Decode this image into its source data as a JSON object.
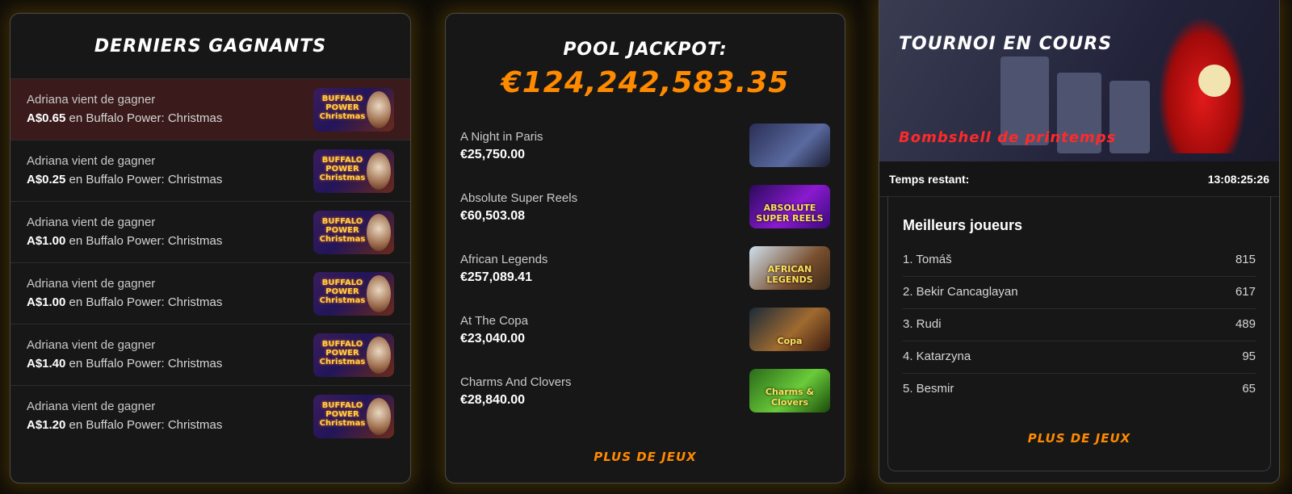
{
  "winners": {
    "title": "Derniers gagnants",
    "items": [
      {
        "text": "Adriana vient de gagner",
        "amount": "A$0.65",
        "game": "en Buffalo Power: Christmas"
      },
      {
        "text": "Adriana vient de gagner",
        "amount": "A$0.25",
        "game": "en Buffalo Power: Christmas"
      },
      {
        "text": "Adriana vient de gagner",
        "amount": "A$1.00",
        "game": "en Buffalo Power: Christmas"
      },
      {
        "text": "Adriana vient de gagner",
        "amount": "A$1.00",
        "game": "en Buffalo Power: Christmas"
      },
      {
        "text": "Adriana vient de gagner",
        "amount": "A$1.40",
        "game": "en Buffalo Power: Christmas"
      },
      {
        "text": "Adriana vient de gagner",
        "amount": "A$1.20",
        "game": "en Buffalo Power: Christmas"
      }
    ],
    "thumb_text": "BUFFALO POWER Christmas"
  },
  "jackpot": {
    "title": "Pool jackpot:",
    "amount": "€124,242,583.35",
    "games": [
      {
        "name": "A Night in Paris",
        "value": "€25,750.00",
        "thumb": ""
      },
      {
        "name": "Absolute Super Reels",
        "value": "€60,503.08",
        "thumb": "ABSOLUTE SUPER REELS"
      },
      {
        "name": "African Legends",
        "value": "€257,089.41",
        "thumb": "AFRICAN LEGENDS"
      },
      {
        "name": "At The Copa",
        "value": "€23,040.00",
        "thumb": "Copa"
      },
      {
        "name": "Charms And Clovers",
        "value": "€28,840.00",
        "thumb": "Charms & Clovers"
      }
    ],
    "more": "Plus de jeux"
  },
  "tournament": {
    "title": "Tournoi en cours",
    "name": "Bombshell de printemps",
    "timer_label": "Temps restant:",
    "timer_value": "13:08:25:26",
    "leaders_title": "Meilleurs joueurs",
    "leaders": [
      {
        "name": "1. Tomáš",
        "points": "815"
      },
      {
        "name": "2. Bekir Cancaglayan",
        "points": "617"
      },
      {
        "name": "3. Rudi",
        "points": "489"
      },
      {
        "name": "4. Katarzyna",
        "points": "95"
      },
      {
        "name": "5. Besmir",
        "points": "65"
      }
    ],
    "more": "Plus de jeux"
  }
}
